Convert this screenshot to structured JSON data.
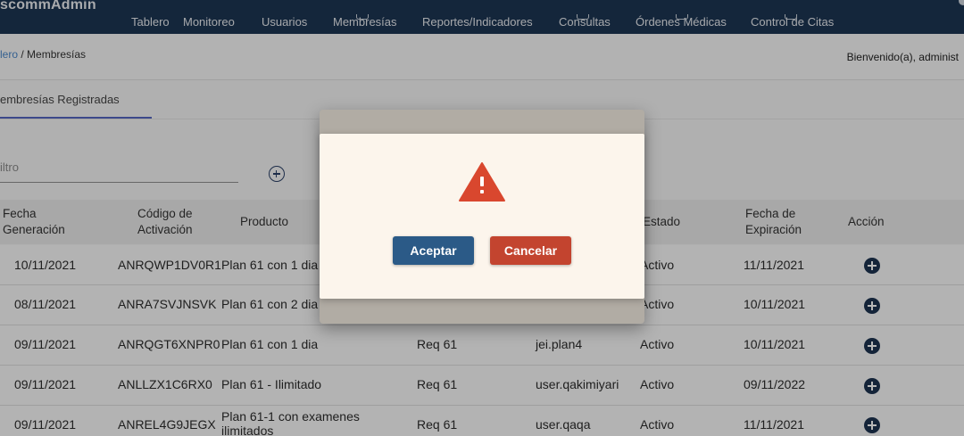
{
  "app": {
    "brand": "scommAdmin"
  },
  "nav": {
    "items": [
      {
        "label": "Tablero"
      },
      {
        "label": "Monitoreo"
      },
      {
        "label": "Usuarios"
      },
      {
        "label": "Membresías"
      },
      {
        "label": "Reportes/Indicadores"
      },
      {
        "label": "Consultas"
      },
      {
        "label": "Órdenes Médicas"
      },
      {
        "label": "Control de Citas"
      }
    ]
  },
  "breadcrumb": {
    "parent": "lero",
    "separator": " / ",
    "current": "Membresías"
  },
  "welcome": "Bienvenido(a), administ",
  "tabs": {
    "active": "embresías Registradas"
  },
  "filter": {
    "placeholder": "iltro"
  },
  "table": {
    "headers": {
      "fecha_generacion": [
        "Fecha",
        "Generación"
      ],
      "codigo": [
        "Código de",
        "Activación"
      ],
      "producto": "Producto",
      "estado": "Estado",
      "fecha_expiracion": [
        "Fecha de",
        "Expiración"
      ],
      "accion": "Acción"
    },
    "rows": [
      {
        "fecha": "10/11/2021",
        "codigo": "ANRQWP1DV0R1",
        "producto": "Plan 61 con 1 dia",
        "req": "",
        "usuario": "",
        "estado": "Activo",
        "expira": "11/11/2021"
      },
      {
        "fecha": "08/11/2021",
        "codigo": "ANRA7SVJNSVK",
        "producto": "Plan 61 con 2 dia",
        "req": "",
        "usuario": "",
        "estado": "Activo",
        "expira": "10/11/2021"
      },
      {
        "fecha": "09/11/2021",
        "codigo": "ANRQGT6XNPR0",
        "producto": "Plan 61 con 1 dia",
        "req": "Req 61",
        "usuario": "jei.plan4",
        "estado": "Activo",
        "expira": "10/11/2021"
      },
      {
        "fecha": "09/11/2021",
        "codigo": "ANLLZX1C6RX0",
        "producto": "Plan 61 - Ilimitado",
        "req": "Req 61",
        "usuario": "user.qakimiyari",
        "estado": "Activo",
        "expira": "09/11/2022"
      },
      {
        "fecha": "09/11/2021",
        "codigo": "ANREL4G9JEGX",
        "producto": "Plan 61-1 con examenes ilimitados",
        "req": "Req 61",
        "usuario": "user.qaqa",
        "estado": "Activo",
        "expira": "11/11/2021"
      }
    ]
  },
  "dialog": {
    "icon": "warning-triangle-icon",
    "accept_label": "Aceptar",
    "cancel_label": "Cancelar",
    "accent_accept": "#2b5a87",
    "accent_cancel": "#c3442f",
    "warning_color": "#d9472e"
  }
}
